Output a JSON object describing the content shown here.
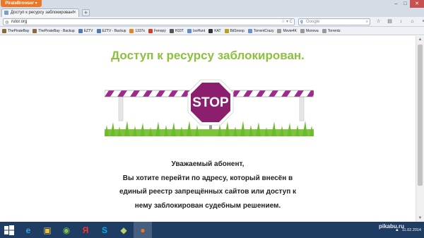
{
  "browser": {
    "app_button": "PirateBrowser",
    "tab_title": "Доступ к ресурсу заблокирован!",
    "url": "rutor.org",
    "search_placeholder": "Google"
  },
  "bookmarks": [
    {
      "label": "ThePirateBay",
      "color": "#8a6a3a"
    },
    {
      "label": "ThePirateBay - Backup",
      "color": "#8a6a3a"
    },
    {
      "label": "EZTV",
      "color": "#4a7bb5"
    },
    {
      "label": "EZTV - Backup",
      "color": "#4a7bb5"
    },
    {
      "label": "1337x",
      "color": "#e0851f"
    },
    {
      "label": "Fenopy",
      "color": "#d93a2b"
    },
    {
      "label": "H33T",
      "color": "#555555"
    },
    {
      "label": "IsoHunt",
      "color": "#5b8ed6"
    },
    {
      "label": "KAT",
      "color": "#333333"
    },
    {
      "label": "BitSnoop",
      "color": "#b8a21c"
    },
    {
      "label": "TorrentCrazy",
      "color": "#6a8fd0"
    },
    {
      "label": "Movie4K",
      "color": "#999999"
    },
    {
      "label": "Monova",
      "color": "#999999"
    },
    {
      "label": "Torrentz",
      "color": "#999999"
    }
  ],
  "page": {
    "headline": "Доступ к ресурсу заблокирован.",
    "stop_sign": "STOP",
    "message_lines": [
      "Уважаемый абонент,",
      "Вы хотите перейти по адресу, который внесён в",
      "единый реестр запрещённых сайтов или доступ к",
      "нему заблокирован судебным решением."
    ]
  },
  "taskbar": {
    "apps": [
      {
        "name": "internet-explorer-icon",
        "glyph": "e",
        "color": "#3aa0e8"
      },
      {
        "name": "file-explorer-icon",
        "glyph": "▣",
        "color": "#e8c14a"
      },
      {
        "name": "media-icon",
        "glyph": "◉",
        "color": "#7fbf5a"
      },
      {
        "name": "yandex-icon",
        "glyph": "Я",
        "color": "#ff3333"
      },
      {
        "name": "skype-icon",
        "glyph": "S",
        "color": "#00aff0"
      },
      {
        "name": "app-icon",
        "glyph": "◆",
        "color": "#b9d36b"
      },
      {
        "name": "firefox-icon",
        "glyph": "●",
        "color": "#e8762a"
      }
    ],
    "watermark": "pikabu.ru",
    "clock_date": "11.02.2014"
  },
  "colors": {
    "headline": "#8cc13f",
    "stop_sign": "#8b1f6e",
    "barrier_stripe": "#9e2a8c"
  }
}
